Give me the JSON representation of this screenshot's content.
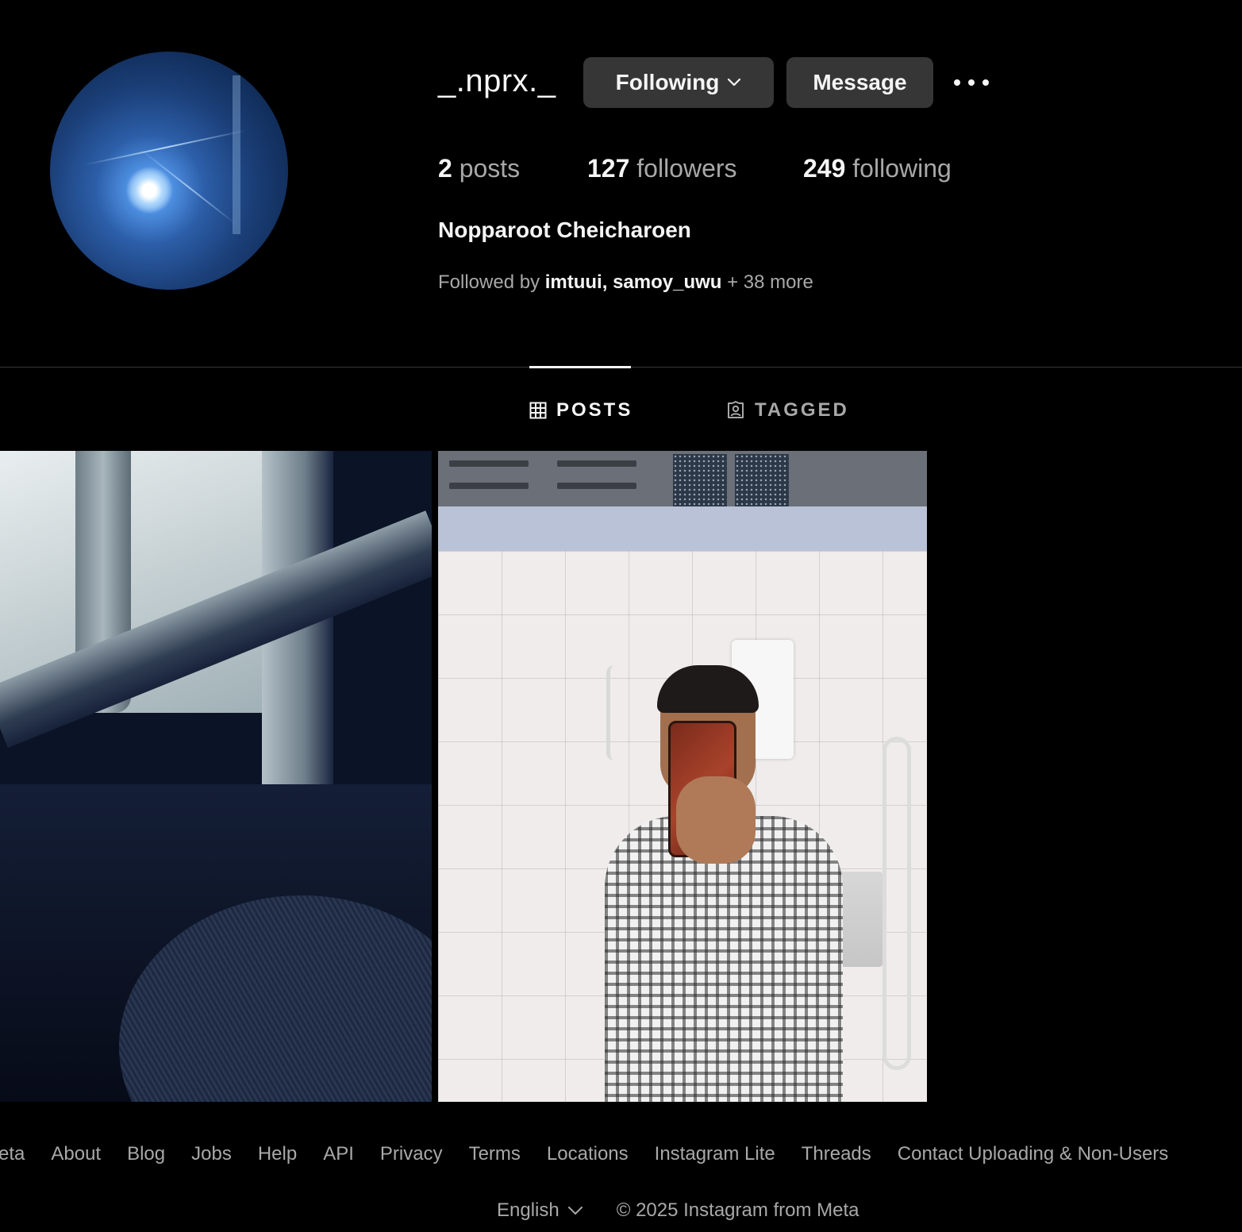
{
  "profile": {
    "username": "_.nprx._",
    "full_name": "Nopparoot Cheicharoen",
    "following_button": "Following",
    "message_button": "Message",
    "stats": {
      "posts_count": "2",
      "posts_label": "posts",
      "followers_count": "127",
      "followers_label": "followers",
      "following_count": "249",
      "following_label": "following"
    },
    "followed_by": {
      "prefix": "Followed by",
      "user1": "imtuui,",
      "user2": "samoy_uwu",
      "suffix": "+ 38 more"
    }
  },
  "tabs": [
    {
      "label": "POSTS",
      "icon": "grid-icon",
      "active": true
    },
    {
      "label": "TAGGED",
      "icon": "tagged-user-icon",
      "active": false
    }
  ],
  "footer": {
    "links": [
      "Meta",
      "About",
      "Blog",
      "Jobs",
      "Help",
      "API",
      "Privacy",
      "Terms",
      "Locations",
      "Instagram Lite",
      "Threads",
      "Contact Uploading & Non-Users"
    ],
    "language": "English",
    "copyright": "© 2025 Instagram from Meta"
  },
  "colors": {
    "background": "#000000",
    "button_bg": "#363636",
    "primary_text": "#f5f5f5",
    "secondary_text": "#a8a8a8"
  }
}
